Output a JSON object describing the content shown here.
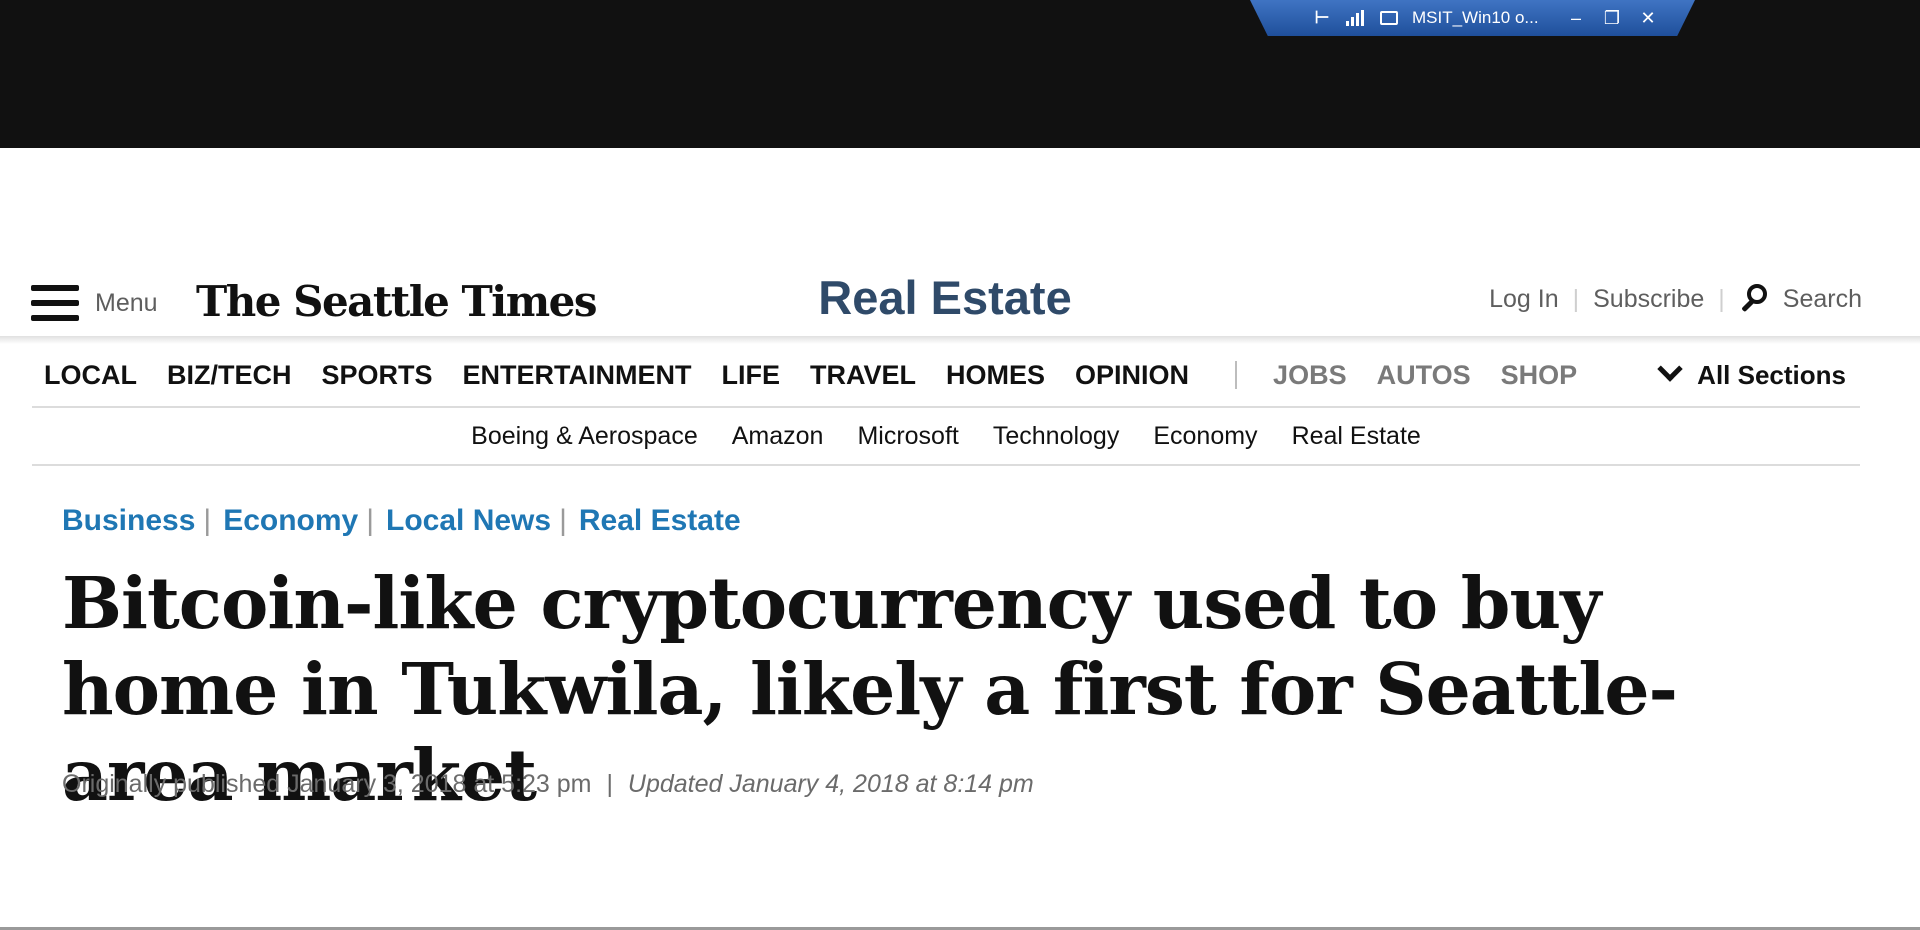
{
  "remote_desktop": {
    "title": "MSIT_Win10 o...",
    "minimize": "–",
    "restore": "❐",
    "close": "✕"
  },
  "header": {
    "menu_label": "Menu",
    "logo_text": "The Seattle Times",
    "section_title": "Real Estate",
    "login": "Log In",
    "subscribe": "Subscribe",
    "search": "Search"
  },
  "main_nav": {
    "items": [
      "LOCAL",
      "BIZ/TECH",
      "SPORTS",
      "ENTERTAINMENT",
      "LIFE",
      "TRAVEL",
      "HOMES",
      "OPINION"
    ],
    "secondary": [
      "JOBS",
      "AUTOS",
      "SHOP"
    ],
    "all_sections": "All Sections"
  },
  "sub_nav": {
    "items": [
      "Boeing & Aerospace",
      "Amazon",
      "Microsoft",
      "Technology",
      "Economy",
      "Real Estate"
    ]
  },
  "article": {
    "breadcrumbs": [
      "Business",
      "Economy",
      "Local News",
      "Real Estate"
    ],
    "headline": "Bitcoin-like cryptocurrency used to buy home in Tukwila, likely a first for Seattle-area market",
    "published": "Originally published January 3, 2018 at 5:23 pm",
    "separator": "|",
    "updated": "Updated January 4, 2018 at 8:14 pm"
  },
  "colors": {
    "section_title": "#2f4a69",
    "breadcrumb_link": "#1f77b4",
    "remote_bar": "#2a5fb0"
  }
}
